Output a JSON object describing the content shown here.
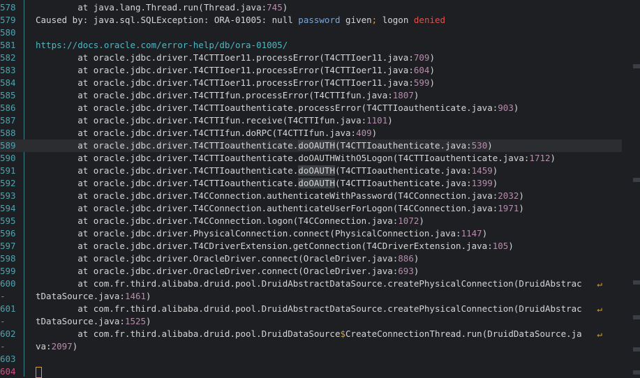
{
  "editor": {
    "lines": [
      {
        "n": "578",
        "text": "        at java.lang.Thread.run(Thread.java:745)"
      },
      {
        "n": "579",
        "text": "Caused by: java.sql.SQLException: ORA-01005: null password given; logon denied"
      },
      {
        "n": "580",
        "text": ""
      },
      {
        "n": "581",
        "text": "https://docs.oracle.com/error-help/db/ora-01005/"
      },
      {
        "n": "582",
        "text": "        at oracle.jdbc.driver.T4CTTIoer11.processError(T4CTTIoer11.java:709)"
      },
      {
        "n": "583",
        "text": "        at oracle.jdbc.driver.T4CTTIoer11.processError(T4CTTIoer11.java:604)"
      },
      {
        "n": "584",
        "text": "        at oracle.jdbc.driver.T4CTTIoer11.processError(T4CTTIoer11.java:599)"
      },
      {
        "n": "585",
        "text": "        at oracle.jdbc.driver.T4CTTIfun.processError(T4CTTIfun.java:1807)"
      },
      {
        "n": "586",
        "text": "        at oracle.jdbc.driver.T4CTTIoauthenticate.processError(T4CTTIoauthenticate.java:903)"
      },
      {
        "n": "587",
        "text": "        at oracle.jdbc.driver.T4CTTIfun.receive(T4CTTIfun.java:1101)"
      },
      {
        "n": "588",
        "text": "        at oracle.jdbc.driver.T4CTTIfun.doRPC(T4CTTIfun.java:409)"
      },
      {
        "n": "589",
        "text": "        at oracle.jdbc.driver.T4CTTIoauthenticate.doOAUTH(T4CTTIoauthenticate.java:530)"
      },
      {
        "n": "590",
        "text": "        at oracle.jdbc.driver.T4CTTIoauthenticate.doOAUTHWithO5Logon(T4CTTIoauthenticate.java:1712)"
      },
      {
        "n": "591",
        "text": "        at oracle.jdbc.driver.T4CTTIoauthenticate.doOAUTH(T4CTTIoauthenticate.java:1459)"
      },
      {
        "n": "592",
        "text": "        at oracle.jdbc.driver.T4CTTIoauthenticate.doOAUTH(T4CTTIoauthenticate.java:1399)"
      },
      {
        "n": "593",
        "text": "        at oracle.jdbc.driver.T4CConnection.authenticateWithPassword(T4CConnection.java:2032)"
      },
      {
        "n": "594",
        "text": "        at oracle.jdbc.driver.T4CConnection.authenticateUserForLogon(T4CConnection.java:1971)"
      },
      {
        "n": "595",
        "text": "        at oracle.jdbc.driver.T4CConnection.logon(T4CConnection.java:1072)"
      },
      {
        "n": "596",
        "text": "        at oracle.jdbc.driver.PhysicalConnection.connect(PhysicalConnection.java:1147)"
      },
      {
        "n": "597",
        "text": "        at oracle.jdbc.driver.T4CDriverExtension.getConnection(T4CDriverExtension.java:105)"
      },
      {
        "n": "598",
        "text": "        at oracle.jdbc.driver.OracleDriver.connect(OracleDriver.java:886)"
      },
      {
        "n": "599",
        "text": "        at oracle.jdbc.driver.OracleDriver.connect(OracleDriver.java:693)"
      },
      {
        "n": "600",
        "text": "        at com.fr.third.alibaba.druid.pool.DruidAbstractDataSource.createPhysicalConnection(DruidAbstrac"
      },
      {
        "n": "-",
        "text": "tDataSource.java:1461)"
      },
      {
        "n": "601",
        "text": "        at com.fr.third.alibaba.druid.pool.DruidAbstractDataSource.createPhysicalConnection(DruidAbstrac"
      },
      {
        "n": "-",
        "text": "tDataSource.java:1525)"
      },
      {
        "n": "602",
        "text": "        at com.fr.third.alibaba.druid.pool.DruidDataSource$CreateConnectionThread.run(DruidDataSource.ja"
      },
      {
        "n": "-",
        "text": "va:2097)"
      },
      {
        "n": "603",
        "text": ""
      },
      {
        "n": "604",
        "text": ""
      }
    ],
    "current_line": "589",
    "wrap_glyph": "↵"
  }
}
